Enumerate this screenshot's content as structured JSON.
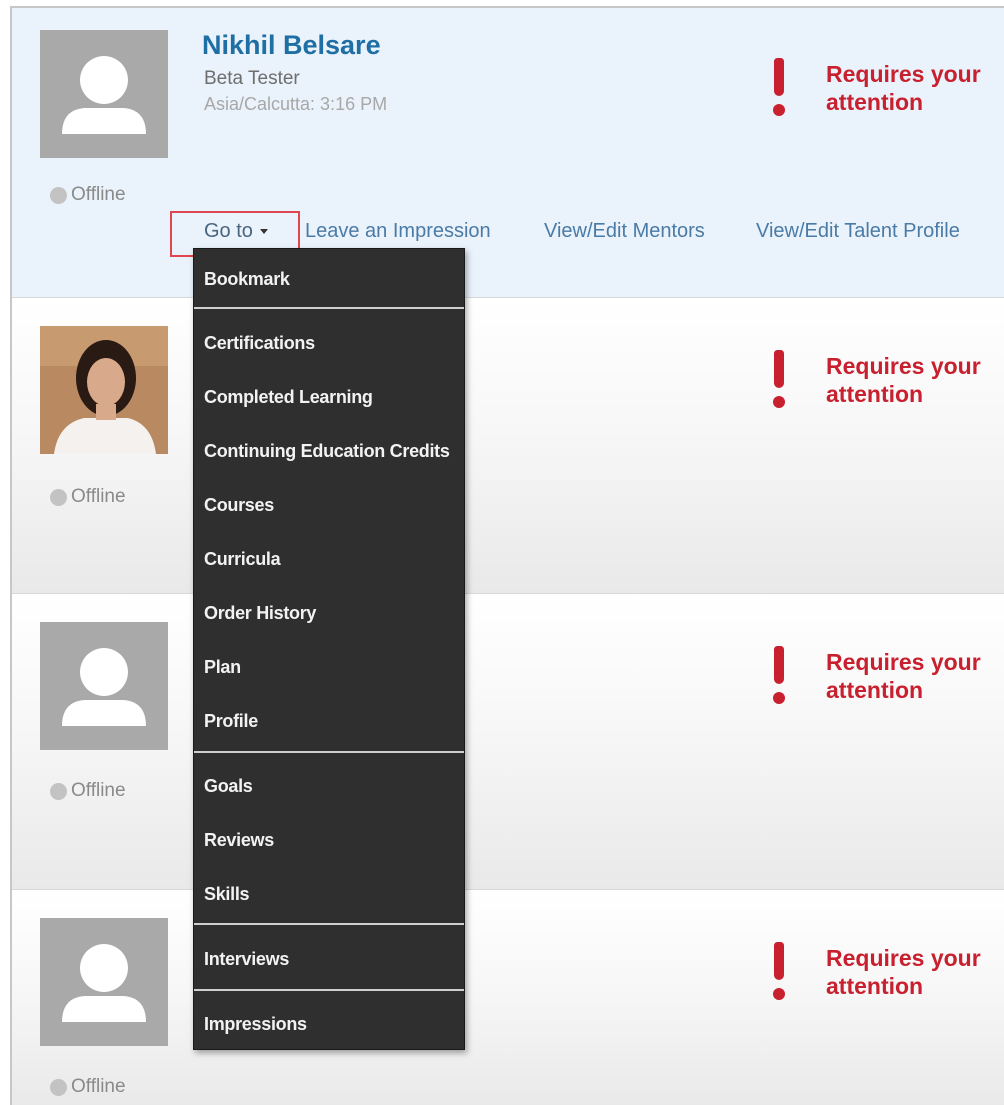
{
  "profile": {
    "name": "Nikhil Belsare",
    "role": "Beta Tester",
    "timezone": "Asia/Calcutta: 3:16 PM",
    "status": "Offline"
  },
  "attention_text": "Requires your attention",
  "nav": {
    "goto_label": "Go to",
    "links": [
      "Leave an Impression",
      "View/Edit Mentors",
      "View/Edit Talent Profile"
    ]
  },
  "menu": {
    "groups": [
      [
        "Bookmark"
      ],
      [
        "Certifications",
        "Completed Learning",
        "Continuing Education Credits",
        "Courses",
        "Curricula",
        "Order History",
        "Plan",
        "Profile"
      ],
      [
        "Goals",
        "Reviews",
        "Skills"
      ],
      [
        "Interviews"
      ],
      [
        "Impressions"
      ]
    ]
  },
  "other_cards": [
    {
      "status": "Offline",
      "avatar": "photo",
      "attention": "Requires your attention"
    },
    {
      "status": "Offline",
      "avatar": "placeholder-user-icon",
      "attention": "Requires your attention"
    },
    {
      "status": "Offline",
      "avatar": "placeholder-user-icon",
      "attention": "Requires your attention"
    }
  ],
  "colors": {
    "name": "#1f6fa5",
    "attention": "#c8202e",
    "menu_bg": "#2f2f2f",
    "highlight_box": "#e0464f",
    "first_card_bg": "#eaf2fb"
  }
}
